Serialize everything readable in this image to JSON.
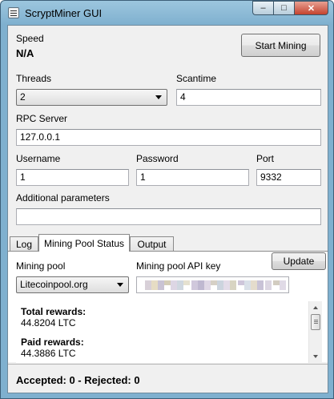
{
  "window": {
    "title": "ScryptMiner GUI",
    "buttons": {
      "minimize": "‒",
      "maximize": "□",
      "close": "✕"
    }
  },
  "speed": {
    "label": "Speed",
    "value": "N/A"
  },
  "start_button": "Start Mining",
  "threads": {
    "label": "Threads",
    "value": "2"
  },
  "scantime": {
    "label": "Scantime",
    "value": "4"
  },
  "rpc_server": {
    "label": "RPC Server",
    "value": "127.0.0.1"
  },
  "username": {
    "label": "Username",
    "value": "1"
  },
  "password": {
    "label": "Password",
    "value": "1"
  },
  "port": {
    "label": "Port",
    "value": "9332"
  },
  "additional_params": {
    "label": "Additional parameters",
    "value": ""
  },
  "tabs": [
    "Log",
    "Mining Pool Status",
    "Output"
  ],
  "active_tab": "Mining Pool Status",
  "pool": {
    "pool_label": "Mining pool",
    "pool_value": "Litecoinpool.org",
    "api_key_label": "Mining pool API key",
    "api_key_obscured": true,
    "update_button": "Update"
  },
  "rewards": {
    "total_label": "Total rewards:",
    "total_value": "44.8204 LTC",
    "paid_label": "Paid rewards:",
    "paid_value": "44.3886 LTC"
  },
  "status": "Accepted: 0 - Rejected: 0",
  "colors": {
    "frame": "#7fb0cf",
    "close_button": "#c4432f",
    "client_background": "#f0f0f0"
  }
}
